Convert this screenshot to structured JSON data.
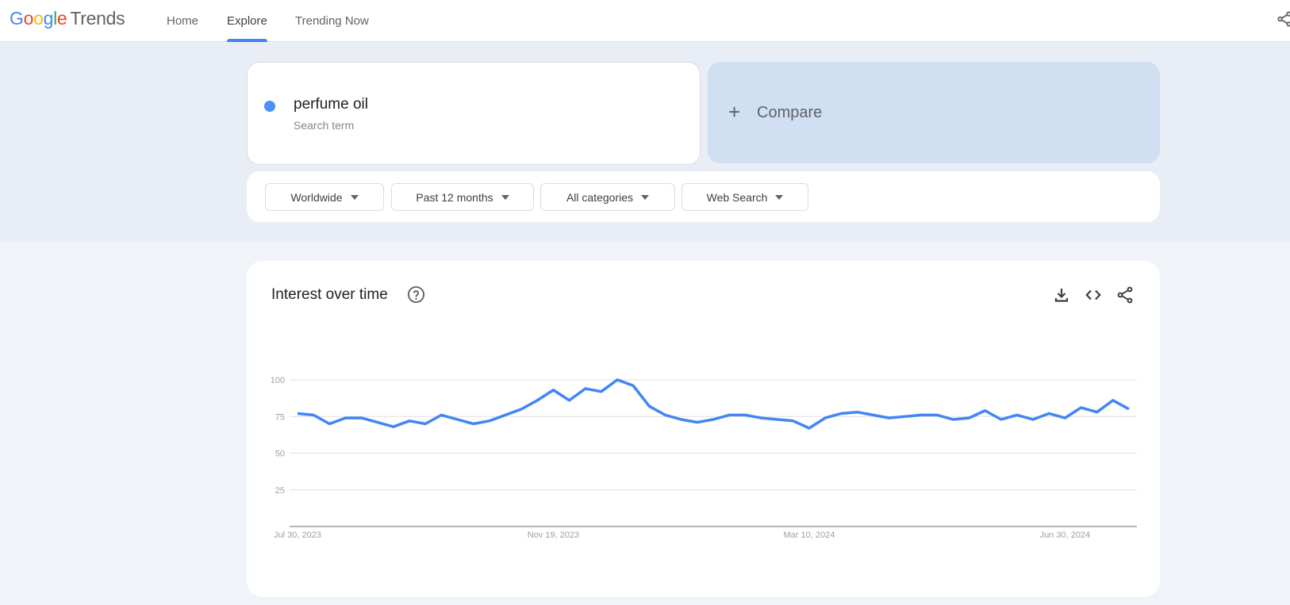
{
  "header": {
    "logo": {
      "google": [
        "G",
        "o",
        "o",
        "g",
        "l",
        "e"
      ],
      "product": "Trends"
    },
    "nav": [
      {
        "label": "Home",
        "active": false
      },
      {
        "label": "Explore",
        "active": true
      },
      {
        "label": "Trending Now",
        "active": false
      }
    ],
    "share_icon": "share-icon"
  },
  "search": {
    "term": "perfume oil",
    "term_type": "Search term",
    "term_color": "#4f8ff7",
    "compare_label": "Compare",
    "compare_icon": "plus-icon"
  },
  "filters": [
    {
      "label": "Worldwide",
      "icon": "caret-down-icon"
    },
    {
      "label": "Past 12 months",
      "icon": "caret-down-icon"
    },
    {
      "label": "All categories",
      "icon": "caret-down-icon"
    },
    {
      "label": "Web Search",
      "icon": "caret-down-icon"
    }
  ],
  "interest_card": {
    "title": "Interest over time",
    "help_icon": "help-circle-icon",
    "tools": [
      "download-icon",
      "embed-code-icon",
      "share-icon"
    ]
  },
  "chart_data": {
    "type": "line",
    "title": "Interest over time",
    "xlabel": "",
    "ylabel": "",
    "ylim": [
      0,
      100
    ],
    "yticks": [
      25,
      50,
      75,
      100
    ],
    "grid": true,
    "legend": "none",
    "x_tick_labels": [
      "Jul 30, 2023",
      "Nov 19, 2023",
      "Mar 10, 2024",
      "Jun 30, 2024"
    ],
    "x_tick_indices": [
      0,
      16,
      32,
      48
    ],
    "series": [
      {
        "name": "perfume oil",
        "color": "#4285f4",
        "values": [
          77,
          76,
          70,
          74,
          74,
          71,
          68,
          72,
          70,
          76,
          73,
          70,
          72,
          76,
          80,
          86,
          93,
          86,
          94,
          92,
          100,
          96,
          82,
          76,
          73,
          71,
          73,
          76,
          76,
          74,
          73,
          72,
          67,
          74,
          77,
          78,
          76,
          74,
          75,
          76,
          76,
          73,
          74,
          79,
          73,
          76,
          73,
          77,
          74,
          81,
          78,
          86,
          80
        ]
      }
    ]
  }
}
